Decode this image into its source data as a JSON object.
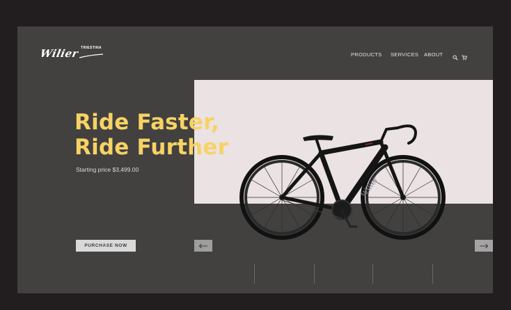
{
  "brand": {
    "name": "Wilier",
    "sub": "TRIESTINA"
  },
  "nav": {
    "items": [
      {
        "label": "PRODUCTS"
      },
      {
        "label": "SERVICES"
      },
      {
        "label": "ABOUT"
      }
    ],
    "icons": [
      "search-icon",
      "cart-icon"
    ]
  },
  "hero": {
    "title_line1": "Ride Faster,",
    "title_line2": "Ride Further",
    "price": "Starting price $3,499.00",
    "purchase_label": "PURCHASE NOW"
  },
  "colors": {
    "background": "#221d1e",
    "frame": "#424140",
    "panel": "#ebe2e3",
    "accent": "#f7d264"
  }
}
